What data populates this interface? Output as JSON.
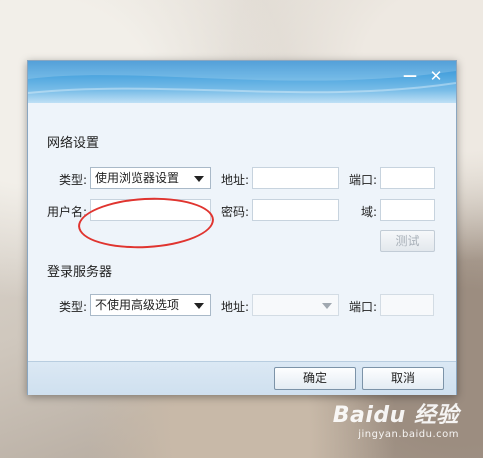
{
  "watermark": {
    "logo": "Baidu 经验",
    "url": "jingyan.baidu.com"
  },
  "dialog": {
    "controls": {
      "minimize": "—",
      "close": "✕"
    },
    "proxy": {
      "title": "网络设置",
      "type_label": "类型:",
      "type_value": "使用浏览器设置",
      "address_label": "地址:",
      "address_value": "",
      "port_label": "端口:",
      "port_value": "",
      "username_label": "用户名:",
      "username_value": "",
      "password_label": "密码:",
      "password_value": "",
      "domain_label": "域:",
      "domain_value": "",
      "test_button": "测试"
    },
    "login_server": {
      "title": "登录服务器",
      "type_label": "类型:",
      "type_value": "不使用高级选项",
      "address_label": "地址:",
      "address_value": "",
      "port_label": "端口:",
      "port_value": ""
    },
    "footer": {
      "ok": "确定",
      "cancel": "取消"
    }
  },
  "colors": {
    "titlebar": "#4fa6df",
    "highlight": "#e0342f",
    "dialog_bg": "#eef4fa"
  }
}
